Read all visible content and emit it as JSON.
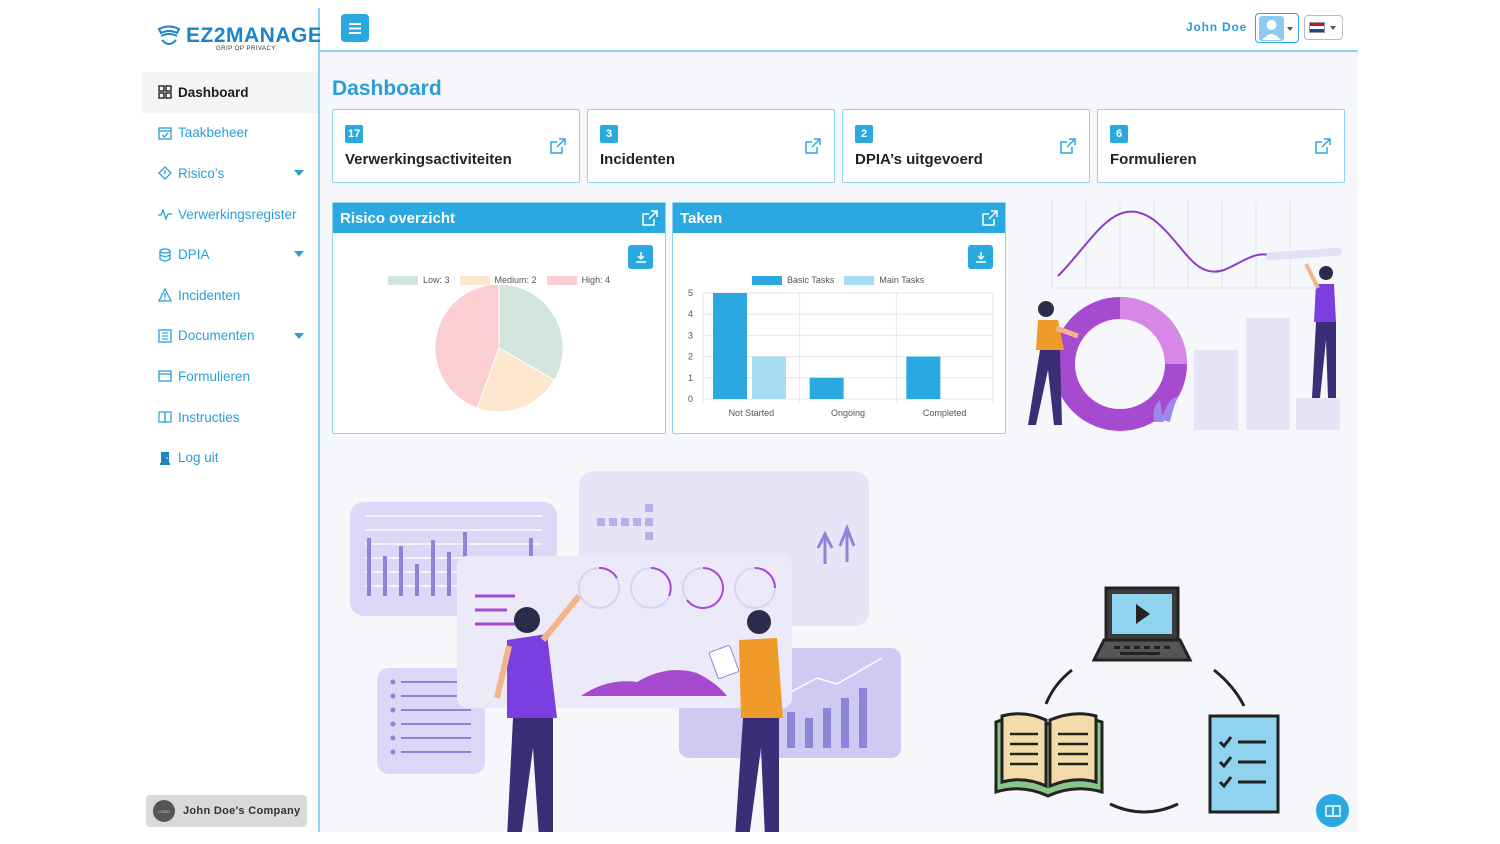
{
  "brand": {
    "name": "EZ2MANAGE",
    "tagline": "GRIP OP PRIVACY"
  },
  "sidebar": {
    "items": [
      {
        "label": "Dashboard",
        "icon": "dashboard-icon",
        "active": true
      },
      {
        "label": "Taakbeheer",
        "icon": "calendar-check-icon"
      },
      {
        "label": "Risico’s",
        "icon": "diamond-icon",
        "dropdown": true
      },
      {
        "label": "Verwerkingsregister",
        "icon": "activity-icon"
      },
      {
        "label": "DPIA",
        "icon": "database-icon",
        "dropdown": true
      },
      {
        "label": "Incidenten",
        "icon": "warning-icon"
      },
      {
        "label": "Documenten",
        "icon": "document-icon",
        "dropdown": true
      },
      {
        "label": "Formulieren",
        "icon": "form-icon"
      },
      {
        "label": "Instructies",
        "icon": "book-icon"
      },
      {
        "label": "Log uit",
        "icon": "door-icon"
      }
    ],
    "company": {
      "name": "John Doe's Company",
      "badge": "LOGO"
    }
  },
  "topbar": {
    "user_name": "John Doe",
    "language": "NL"
  },
  "page": {
    "title": "Dashboard"
  },
  "stats": [
    {
      "value": "17",
      "label": "Verwerkingsactiviteiten"
    },
    {
      "value": "3",
      "label": "Incidenten"
    },
    {
      "value": "2",
      "label": "DPIA’s uitgevoerd"
    },
    {
      "value": "6",
      "label": "Formulieren"
    }
  ],
  "panels": {
    "risk": {
      "title": "Risico overzicht"
    },
    "tasks": {
      "title": "Taken"
    }
  },
  "colors": {
    "accent": "#29a9e0",
    "low": "#d2e6dd",
    "medium": "#fde8cf",
    "high": "#fbcfd2",
    "basic": "#29a9e0",
    "main": "#a5ddf5"
  },
  "chart_data": [
    {
      "type": "pie",
      "legend": [
        "Low: 3",
        "Medium: 2",
        "High: 4"
      ],
      "labels": [
        "Low",
        "Medium",
        "High"
      ],
      "values": [
        3,
        2,
        4
      ]
    },
    {
      "type": "bar",
      "categories": [
        "Not Started",
        "Ongoing",
        "Completed"
      ],
      "series": [
        {
          "name": "Basic Tasks",
          "values": [
            5,
            1,
            2
          ]
        },
        {
          "name": "Main Tasks",
          "values": [
            2,
            0,
            0
          ]
        }
      ],
      "yticks": [
        "0",
        "1",
        "2",
        "3",
        "4",
        "5"
      ],
      "ylim": [
        0,
        5
      ],
      "grid": true,
      "legend_position": "top"
    }
  ]
}
